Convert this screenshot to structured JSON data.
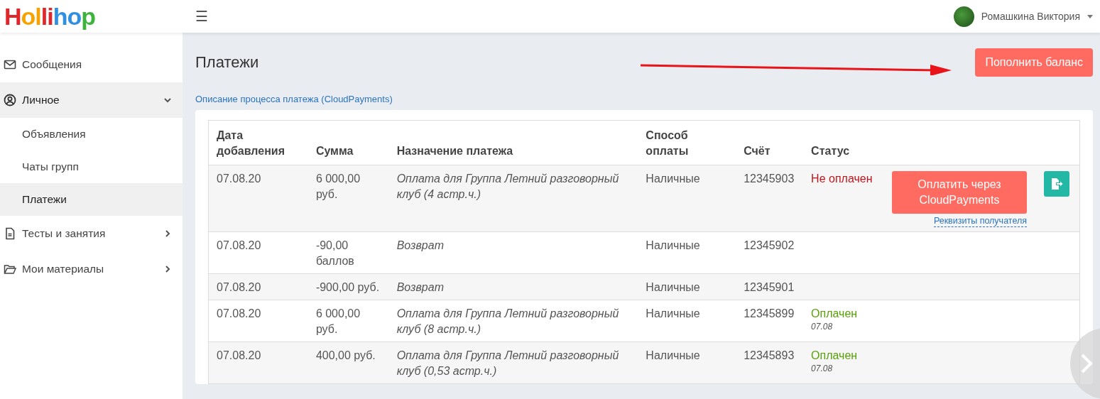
{
  "header": {
    "logo": "Hollihop",
    "menu_icon": "☰",
    "user_name": "Ромашкина Виктория"
  },
  "sidebar": {
    "items": [
      {
        "label": "Сообщения",
        "selected": false,
        "expanded": false,
        "has_arrow": false
      },
      {
        "label": "Личное",
        "selected": false,
        "expanded": true,
        "has_arrow": true,
        "children": [
          {
            "label": "Объявления",
            "selected": false
          },
          {
            "label": "Чаты групп",
            "selected": false
          },
          {
            "label": "Платежи",
            "selected": true
          }
        ]
      },
      {
        "label": "Тесты и занятия",
        "selected": false,
        "expanded": false,
        "has_arrow": true
      },
      {
        "label": "Мои материалы",
        "selected": false,
        "expanded": false,
        "has_arrow": true
      }
    ]
  },
  "page": {
    "title": "Платежи",
    "top_up_button": "Пополнить баланс",
    "description_link": "Описание процесса платежа (CloudPayments)"
  },
  "table": {
    "columns": [
      "Дата добавления",
      "Сумма",
      "Назначение платежа",
      "Способ оплаты",
      "Счёт",
      "Статус"
    ],
    "rows": [
      {
        "date": "07.08.20",
        "amount": "6 000,00 руб.",
        "purpose": "Оплата для Группа Летний разговорный клуб (4 астр.ч.)",
        "method": "Наличные",
        "invoice": "12345903",
        "status": {
          "kind": "unpaid",
          "text": "Не оплачен"
        },
        "pay_button": "Оплатить через CloudPayments",
        "details_link": "Реквизиты получателя",
        "export_icon": true
      },
      {
        "date": "07.08.20",
        "amount": "-90,00 баллов",
        "purpose": "Возврат",
        "method": "Наличные",
        "invoice": "12345902"
      },
      {
        "date": "07.08.20",
        "amount": "-900,00 руб.",
        "purpose": "Возврат",
        "method": "Наличные",
        "invoice": "12345901"
      },
      {
        "date": "07.08.20",
        "amount": "6 000,00 руб.",
        "purpose": "Оплата для Группа Летний разговорный клуб (8 астр.ч.)",
        "method": "Наличные",
        "invoice": "12345899",
        "status": {
          "kind": "paid",
          "text": "Оплачен",
          "date": "07.08"
        }
      },
      {
        "date": "07.08.20",
        "amount": "400,00 руб.",
        "purpose": "Оплата для Группа Летний разговорный клуб (0,53 астр.ч.)",
        "method": "Наличные",
        "invoice": "12345893",
        "status": {
          "kind": "paid",
          "text": "Оплачен",
          "date": "07.08"
        }
      }
    ]
  }
}
